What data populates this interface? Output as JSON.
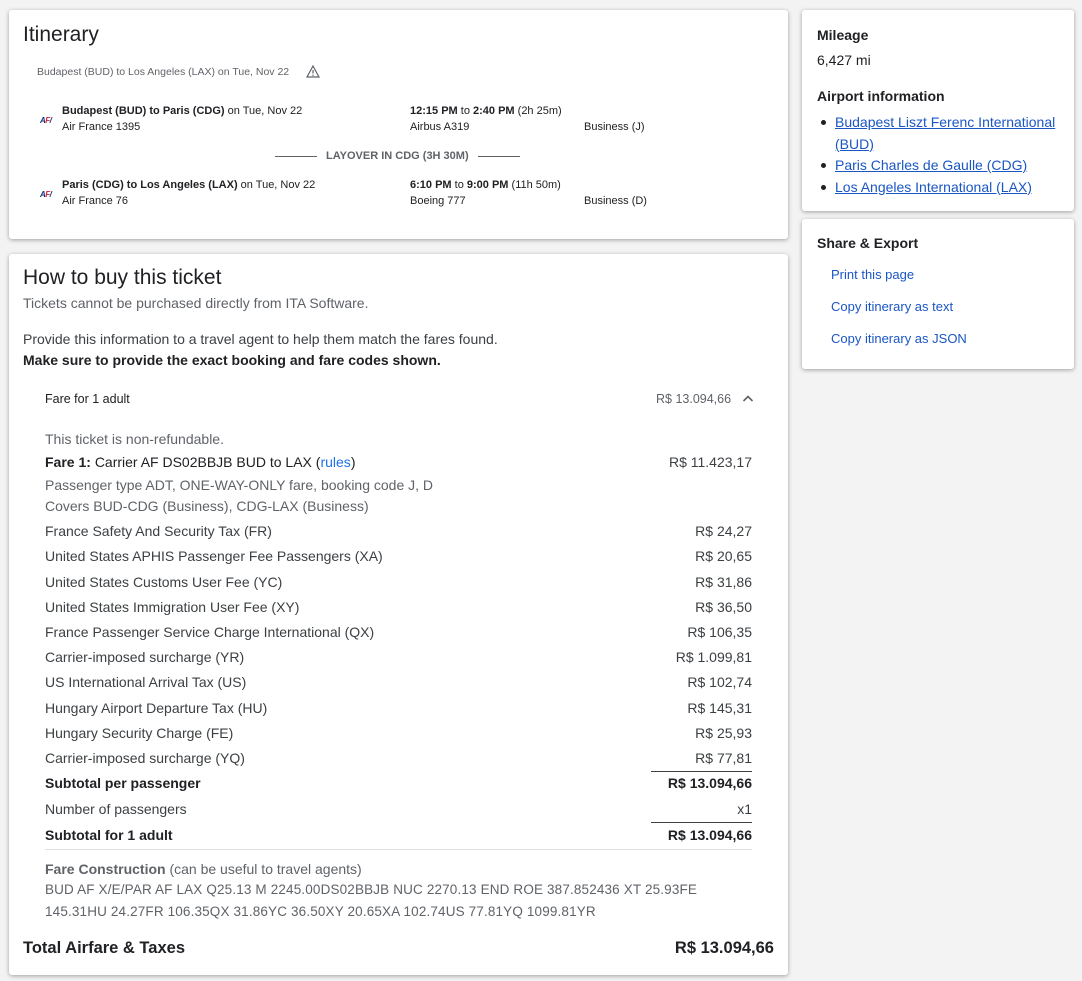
{
  "itinerary": {
    "title": "Itinerary",
    "route_summary": "Budapest (BUD) to Los Angeles (LAX) on Tue, Nov 22",
    "airline_logo_text": "AF",
    "warning_icon": "warning-icon",
    "segments": [
      {
        "route": "Budapest (BUD) to Paris (CDG)",
        "date": "on Tue, Nov 22",
        "flight": "Air France 1395",
        "dep": "12:15 PM",
        "to": "to",
        "arr": "2:40 PM",
        "duration": "(2h 25m)",
        "aircraft": "Airbus A319",
        "cabin": "Business (J)"
      },
      {
        "route": "Paris (CDG) to Los Angeles (LAX)",
        "date": "on Tue, Nov 22",
        "flight": "Air France 76",
        "dep": "6:10 PM",
        "to": "to",
        "arr": "9:00 PM",
        "duration": "(11h 50m)",
        "aircraft": "Boeing 777",
        "cabin": "Business (D)"
      }
    ],
    "layover": "LAYOVER IN CDG (3H 30M)"
  },
  "howto": {
    "title": "How to buy this ticket",
    "subtitle": "Tickets cannot be purchased directly from ITA Software.",
    "instructions": "Provide this information to a travel agent to help them match the fares found.",
    "instructions_bold": "Make sure to provide the exact booking and fare codes shown.",
    "fare_header_label": "Fare for 1 adult",
    "fare_header_value": "R$ 13.094,66",
    "nonrefundable": "This ticket is non-refundable.",
    "fare1_prefix": "Fare 1:",
    "fare1_text": "Carrier AF DS02BBJB BUD to LAX (",
    "fare1_link": "rules",
    "fare1_close": ")",
    "fare1_value": "R$ 11.423,17",
    "fare1_line2": "Passenger type ADT, ONE-WAY-ONLY fare, booking code J, D",
    "fare1_line3": "Covers BUD-CDG (Business), CDG-LAX (Business)",
    "taxes": [
      {
        "label": "France Safety And Security Tax (FR)",
        "value": "R$ 24,27"
      },
      {
        "label": "United States APHIS Passenger Fee Passengers (XA)",
        "value": "R$ 20,65"
      },
      {
        "label": "United States Customs User Fee (YC)",
        "value": "R$ 31,86"
      },
      {
        "label": "United States Immigration User Fee (XY)",
        "value": "R$ 36,50"
      },
      {
        "label": "France Passenger Service Charge International (QX)",
        "value": "R$ 106,35"
      },
      {
        "label": "Carrier-imposed surcharge (YR)",
        "value": "R$ 1.099,81"
      },
      {
        "label": "US International Arrival Tax (US)",
        "value": "R$ 102,74"
      },
      {
        "label": "Hungary Airport Departure Tax (HU)",
        "value": "R$ 145,31"
      },
      {
        "label": "Hungary Security Charge (FE)",
        "value": "R$ 25,93"
      },
      {
        "label": "Carrier-imposed surcharge (YQ)",
        "value": "R$ 77,81"
      }
    ],
    "subtotal_pp_label": "Subtotal per passenger",
    "subtotal_pp_value": "R$ 13.094,66",
    "num_pax_label": "Number of passengers",
    "num_pax_value": "x1",
    "subtotal_adult_label": "Subtotal for 1 adult",
    "subtotal_adult_value": "R$ 13.094,66",
    "fare_construction_label": "Fare Construction",
    "fare_construction_note": "(can be useful to travel agents)",
    "fare_construction_line1": "BUD AF X/E/PAR AF LAX Q25.13 M 2245.00DS02BBJB NUC 2270.13 END ROE 387.852436 XT 25.93FE",
    "fare_construction_line2": "145.31HU 24.27FR 106.35QX 31.86YC 36.50XY 20.65XA 102.74US 77.81YQ 1099.81YR",
    "total_label": "Total Airfare & Taxes",
    "total_value": "R$ 13.094,66"
  },
  "sidebar": {
    "mileage_title": "Mileage",
    "mileage_value": "6,427 mi",
    "airport_title": "Airport information",
    "airports": [
      {
        "name": "Budapest Liszt Ferenc International (BUD)"
      },
      {
        "name": "Paris Charles de Gaulle (CDG)"
      },
      {
        "name": "Los Angeles International (LAX)"
      }
    ],
    "share_title": "Share & Export",
    "share_links": [
      "Print this page",
      "Copy itinerary as text",
      "Copy itinerary as JSON"
    ]
  }
}
